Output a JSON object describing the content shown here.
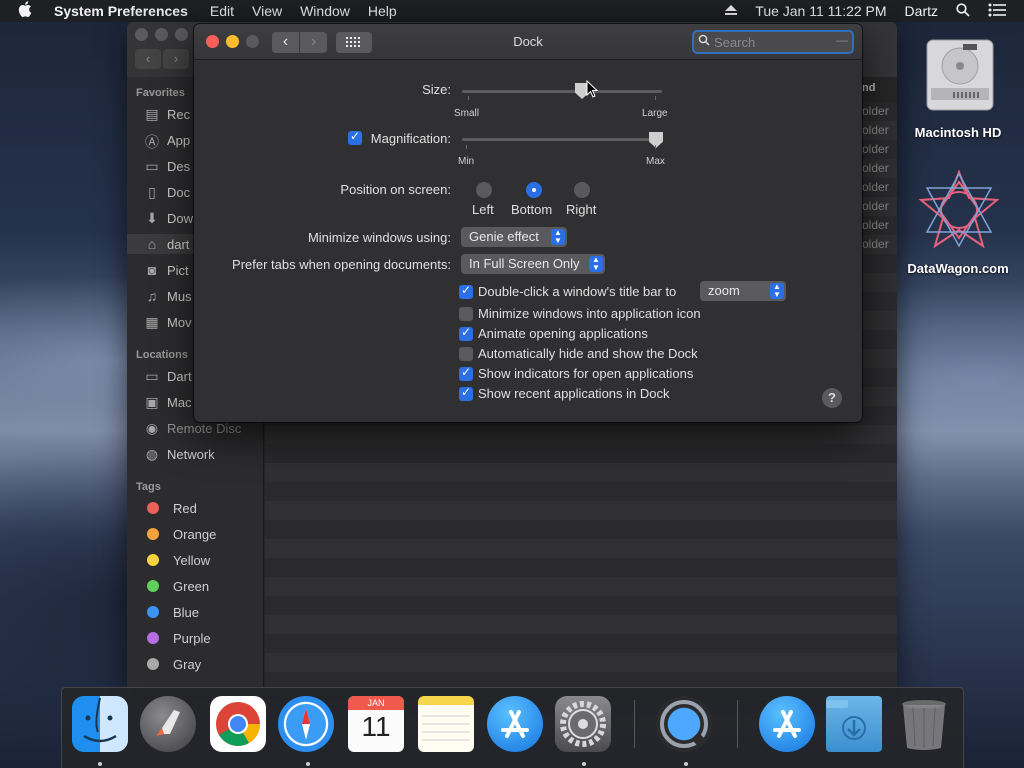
{
  "menubar": {
    "apple_icon": "apple-logo",
    "app_name": "System Preferences",
    "menus": [
      "Edit",
      "View",
      "Window",
      "Help"
    ],
    "datetime": "Tue Jan 11  11:22 PM",
    "user": "Dartz"
  },
  "finder": {
    "favorites_header": "Favorites",
    "favorites": [
      "Rec",
      "App",
      "Des",
      "Doc",
      "Dow",
      "dart",
      "Pict",
      "Mus",
      "Mov"
    ],
    "locations_header": "Locations",
    "locations": [
      "Dart",
      "Mac",
      "Remote Disc",
      "Network"
    ],
    "tags_header": "Tags",
    "tags": [
      {
        "label": "Red",
        "color": "#ec5f5a"
      },
      {
        "label": "Orange",
        "color": "#f4a33c"
      },
      {
        "label": "Yellow",
        "color": "#f5d33f"
      },
      {
        "label": "Green",
        "color": "#5fcf5a"
      },
      {
        "label": "Blue",
        "color": "#3d92f5"
      },
      {
        "label": "Purple",
        "color": "#b76ee3"
      },
      {
        "label": "Gray",
        "color": "#a9a9a9"
      }
    ],
    "kind_header": "nd",
    "kind_cell": "older"
  },
  "prefs": {
    "title": "Dock",
    "search_placeholder": "Search",
    "size": {
      "label": "Size:",
      "min_label": "Small",
      "max_label": "Large",
      "value": 0.6
    },
    "magnification": {
      "label": "Magnification:",
      "checked": true,
      "min_label": "Min",
      "max_label": "Max",
      "value": 0.97
    },
    "position": {
      "label": "Position on screen:",
      "options": [
        "Left",
        "Bottom",
        "Right"
      ],
      "selected": "Bottom"
    },
    "minimize_using": {
      "label": "Minimize windows using:",
      "value": "Genie effect"
    },
    "prefer_tabs": {
      "label": "Prefer tabs when opening documents:",
      "value": "In Full Screen Only"
    },
    "double_click": {
      "label": "Double-click a window's title bar to",
      "value": "zoom",
      "checked": true
    },
    "checkboxes": [
      {
        "label": "Minimize windows into application icon",
        "checked": false
      },
      {
        "label": "Animate opening applications",
        "checked": true
      },
      {
        "label": "Automatically hide and show the Dock",
        "checked": false
      },
      {
        "label": "Show indicators for open applications",
        "checked": true
      },
      {
        "label": "Show recent applications in Dock",
        "checked": true
      }
    ],
    "help_label": "?"
  },
  "desktop": {
    "hd_label": "Macintosh HD",
    "datawagon_label": "DataWagon.com"
  },
  "dock": {
    "apps": [
      "Finder",
      "Launchpad",
      "Chrome",
      "Safari",
      "Calendar",
      "Notes",
      "App Store",
      "System Preferences",
      "QuickTime Player",
      "App Store",
      "Downloads",
      "Trash"
    ],
    "calendar_month": "JAN",
    "calendar_day": "11"
  }
}
